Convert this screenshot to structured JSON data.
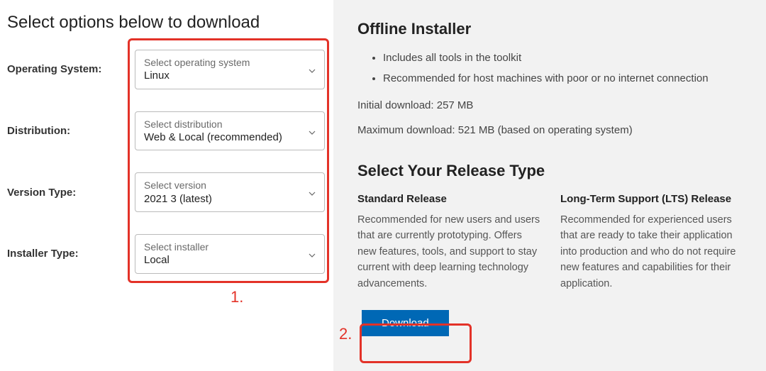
{
  "page_title": "Select options below to download",
  "form": {
    "os": {
      "label": "Operating System:",
      "placeholder": "Select operating system",
      "value": "Linux"
    },
    "dist": {
      "label": "Distribution:",
      "placeholder": "Select distribution",
      "value": "Web & Local (recommended)"
    },
    "version": {
      "label": "Version Type:",
      "placeholder": "Select version",
      "value": "2021 3 (latest)"
    },
    "installer": {
      "label": "Installer Type:",
      "placeholder": "Select installer",
      "value": "Local"
    }
  },
  "annotations": {
    "one": "1.",
    "two": "2."
  },
  "offline": {
    "title": "Offline Installer",
    "bullets": [
      "Includes all tools in the toolkit",
      "Recommended for host machines with poor or no internet connection"
    ],
    "initial": "Initial download: 257 MB",
    "maximum": "Maximum download: 521 MB (based on operating system)"
  },
  "release": {
    "title": "Select Your Release Type",
    "standard": {
      "header": "Standard Release",
      "desc": "Recommended for new users and users that are currently prototyping. Offers new features, tools, and support to stay current with deep learning technology advancements."
    },
    "lts": {
      "header": "Long-Term Support (LTS) Release",
      "desc": "Recommended for experienced users that are ready to take their application into production and who do not require new features and capabilities for their application."
    }
  },
  "download_label": "Download"
}
